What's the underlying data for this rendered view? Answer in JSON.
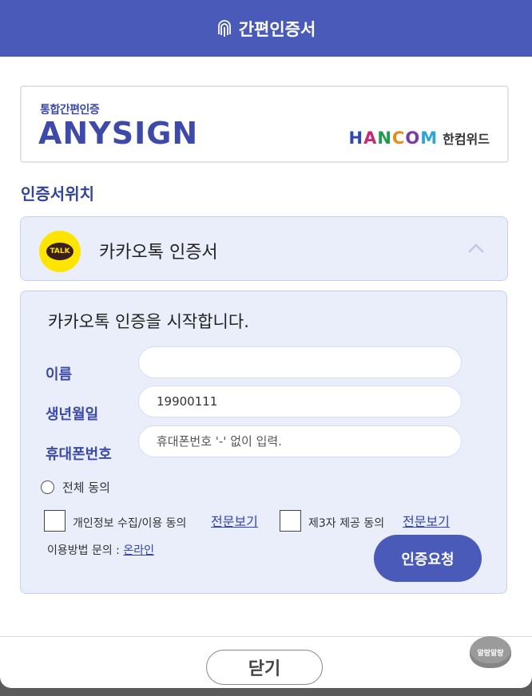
{
  "title": {
    "text": "간편인증서",
    "icon": "fingerprint-icon"
  },
  "brand": {
    "sub": "통합간편인증",
    "name": "ANYSIGN",
    "partner_en_letters": [
      "H",
      "A",
      "N",
      "C",
      "O",
      "M"
    ],
    "partner_ko": "한컴위드"
  },
  "location_title": "인증서위치",
  "provider": {
    "label": "카카오톡 인증서",
    "icon_text": "TALK"
  },
  "panel": {
    "title": "카카오톡 인증을 시작합니다.",
    "fields": {
      "name": {
        "label": "이름",
        "value": "",
        "placeholder": ""
      },
      "birth": {
        "label": "생년월일",
        "value": "19900111",
        "placeholder": ""
      },
      "phone": {
        "label": "휴대폰번호",
        "value": "",
        "placeholder": "휴대폰번호 '-' 없이 입력."
      }
    },
    "agree_all": "전체 동의",
    "consent1": {
      "label": "개인정보 수집/이용 동의",
      "link": "전문보기"
    },
    "consent2": {
      "label": "제3자 제공 동의",
      "link": "전문보기"
    },
    "help_label": "이용방법 문의 : ",
    "help_link": "온라인",
    "submit": "인증요청"
  },
  "close": "닫기",
  "mascot_text": "알랑알랑",
  "colors": {
    "primary": "#4a5ab8",
    "panel_bg": "#eaedfa",
    "kakao_yellow": "#fee500",
    "link": "#2f44b5"
  }
}
